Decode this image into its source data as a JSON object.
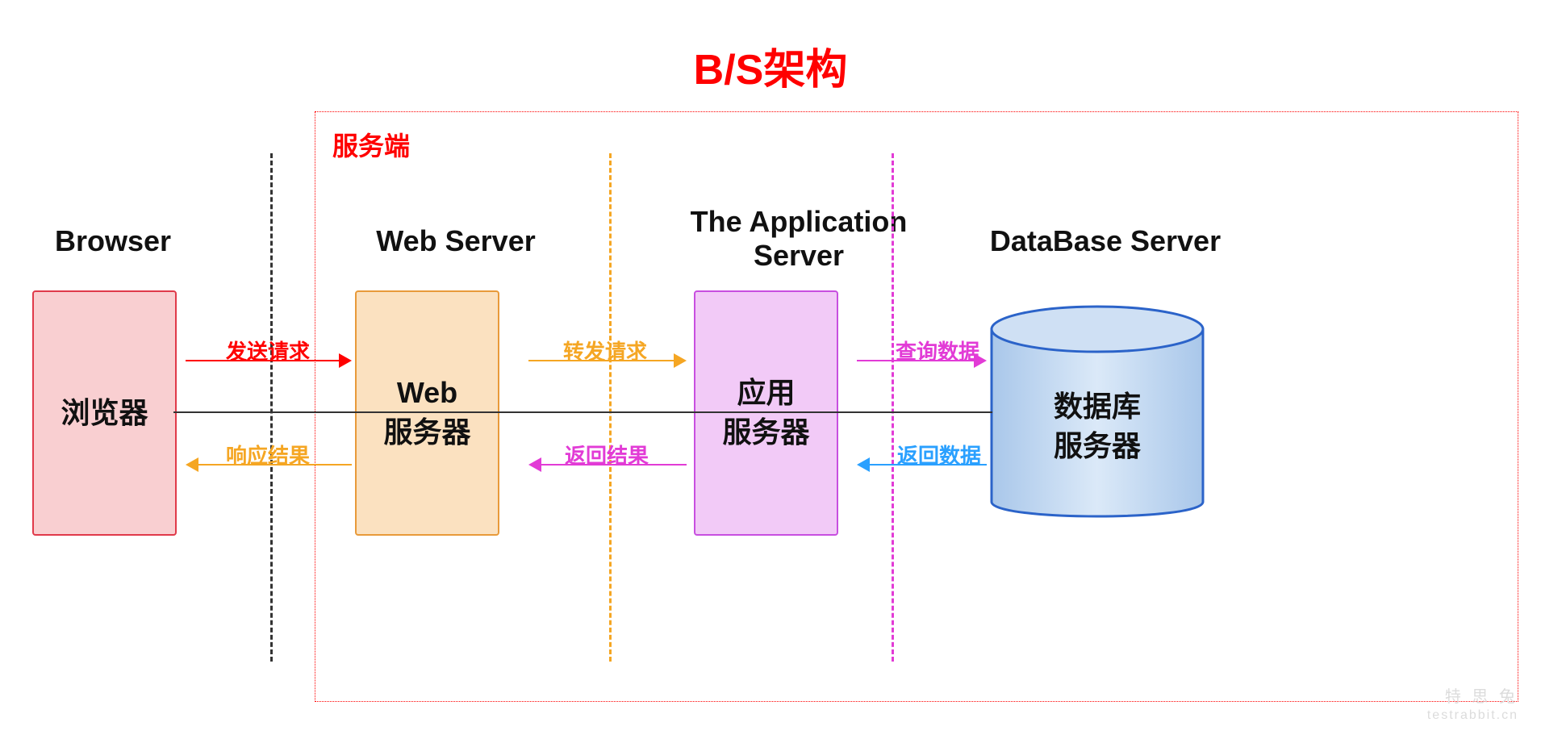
{
  "title": "B/S架构",
  "server_container_label": "服务端",
  "columns": {
    "browser": {
      "title": "Browser",
      "box": "浏览器"
    },
    "web": {
      "title": "Web Server",
      "line1": "Web",
      "line2": "服务器"
    },
    "app": {
      "title_l1": "The Application",
      "title_l2": "Server",
      "line1": "应用",
      "line2": "服务器"
    },
    "db": {
      "title": "DataBase Server",
      "line1": "数据库",
      "line2": "服务器"
    }
  },
  "flows": {
    "f1_req": {
      "text": "发送请求",
      "color": "#ff0000"
    },
    "f1_resp": {
      "text": "响应结果",
      "color": "#f5a623"
    },
    "f2_req": {
      "text": "转发请求",
      "color": "#f5a623"
    },
    "f2_resp": {
      "text": "返回结果",
      "color": "#e23bd6"
    },
    "f3_req": {
      "text": "查询数据",
      "color": "#e23bd6"
    },
    "f3_resp": {
      "text": "返回数据",
      "color": "#2aa0ff"
    }
  },
  "divider_colors": {
    "d1": "#333333",
    "d2": "#f5a623",
    "d3": "#e23bd6"
  },
  "watermark": {
    "line1": "特 思 兔",
    "line2": "testrabbit.cn"
  }
}
